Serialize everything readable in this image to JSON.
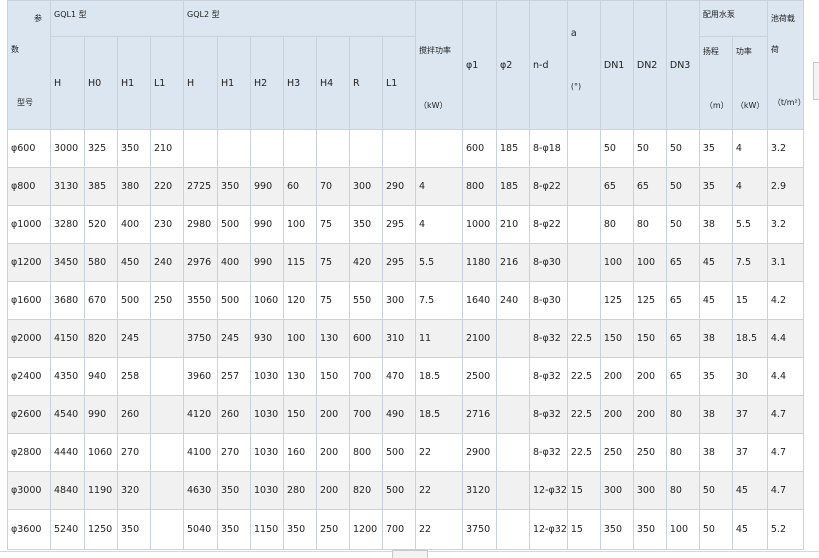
{
  "header": {
    "param_top": "参",
    "param_mid": "数",
    "param_bottom": "型号",
    "gql1": "GQL1 型",
    "gql2": "GQL2 型",
    "power": "搅拌功率",
    "power_unit": "（kW）",
    "phi1": "φ1",
    "phi2": "φ2",
    "nd": "n-d",
    "a": "a",
    "a_unit": "(°)",
    "dn1": "DN1",
    "dn2": "DN2",
    "dn3": "DN3",
    "pump": "配用水泵",
    "head": "扬程",
    "head_unit": "（m）",
    "pump_power": "功率",
    "pump_power_unit": "（kW）",
    "load_top": "池荷载",
    "load_mid": "荷",
    "load_unit": "（t/m²）",
    "gql1_cols": [
      "H",
      "H0",
      "H1",
      "L1"
    ],
    "gql2_cols": [
      "H",
      "H1",
      "H2",
      "H3",
      "H4",
      "R",
      "L1"
    ]
  },
  "rows": [
    [
      "φ600",
      "3000",
      "325",
      "350",
      "210",
      "",
      "",
      "",
      "",
      "",
      "",
      "",
      "",
      "600",
      "185",
      "8-φ18",
      "",
      "50",
      "50",
      "50",
      "35",
      "4",
      "3.2"
    ],
    [
      "φ800",
      "3130",
      "385",
      "380",
      "220",
      "2725",
      "350",
      "990",
      "60",
      "70",
      "300",
      "290",
      "4",
      "800",
      "185",
      "8-φ22",
      "",
      "65",
      "65",
      "50",
      "35",
      "4",
      "2.9"
    ],
    [
      "φ1000",
      "3280",
      "520",
      "400",
      "230",
      "2980",
      "500",
      "990",
      "100",
      "75",
      "350",
      "295",
      "4",
      "1000",
      "210",
      "8-φ22",
      "",
      "80",
      "80",
      "50",
      "38",
      "5.5",
      "3.2"
    ],
    [
      "φ1200",
      "3450",
      "580",
      "450",
      "240",
      "2976",
      "400",
      "990",
      "115",
      "75",
      "420",
      "295",
      "5.5",
      "1180",
      "216",
      "8-φ30",
      "",
      "100",
      "100",
      "65",
      "45",
      "7.5",
      "3.1"
    ],
    [
      "φ1600",
      "3680",
      "670",
      "500",
      "250",
      "3550",
      "500",
      "1060",
      "120",
      "75",
      "550",
      "300",
      "7.5",
      "1640",
      "240",
      "8-φ30",
      "",
      "125",
      "125",
      "65",
      "45",
      "15",
      "4.2"
    ],
    [
      "φ2000",
      "4150",
      "820",
      "245",
      "",
      "3750",
      "245",
      "930",
      "100",
      "130",
      "600",
      "310",
      "11",
      "2100",
      "",
      "8-φ32",
      "22.5",
      "150",
      "150",
      "65",
      "38",
      "18.5",
      "4.4"
    ],
    [
      "φ2400",
      "4350",
      "940",
      "258",
      "",
      "3960",
      "257",
      "1030",
      "130",
      "150",
      "700",
      "470",
      "18.5",
      "2500",
      "",
      "8-φ32",
      "22.5",
      "200",
      "200",
      "65",
      "35",
      "30",
      "4.4"
    ],
    [
      "φ2600",
      "4540",
      "990",
      "260",
      "",
      "4120",
      "260",
      "1030",
      "150",
      "200",
      "700",
      "490",
      "18.5",
      "2716",
      "",
      "8-φ32",
      "22.5",
      "200",
      "200",
      "80",
      "38",
      "37",
      "4.7"
    ],
    [
      "φ2800",
      "4440",
      "1060",
      "270",
      "",
      "4100",
      "270",
      "1030",
      "160",
      "200",
      "800",
      "500",
      "22",
      "2900",
      "",
      "8-φ32",
      "22.5",
      "250",
      "250",
      "80",
      "38",
      "37",
      "4.7"
    ],
    [
      "φ3000",
      "4840",
      "1190",
      "320",
      "",
      "4630",
      "350",
      "1030",
      "280",
      "200",
      "820",
      "500",
      "22",
      "3120",
      "",
      "12-φ32",
      "15",
      "300",
      "300",
      "80",
      "50",
      "45",
      "4.7"
    ],
    [
      "φ3600",
      "5240",
      "1250",
      "350",
      "",
      "5040",
      "350",
      "1150",
      "350",
      "250",
      "1200",
      "700",
      "22",
      "3750",
      "",
      "12-φ32",
      "15",
      "350",
      "350",
      "100",
      "50",
      "45",
      "5.2"
    ]
  ]
}
